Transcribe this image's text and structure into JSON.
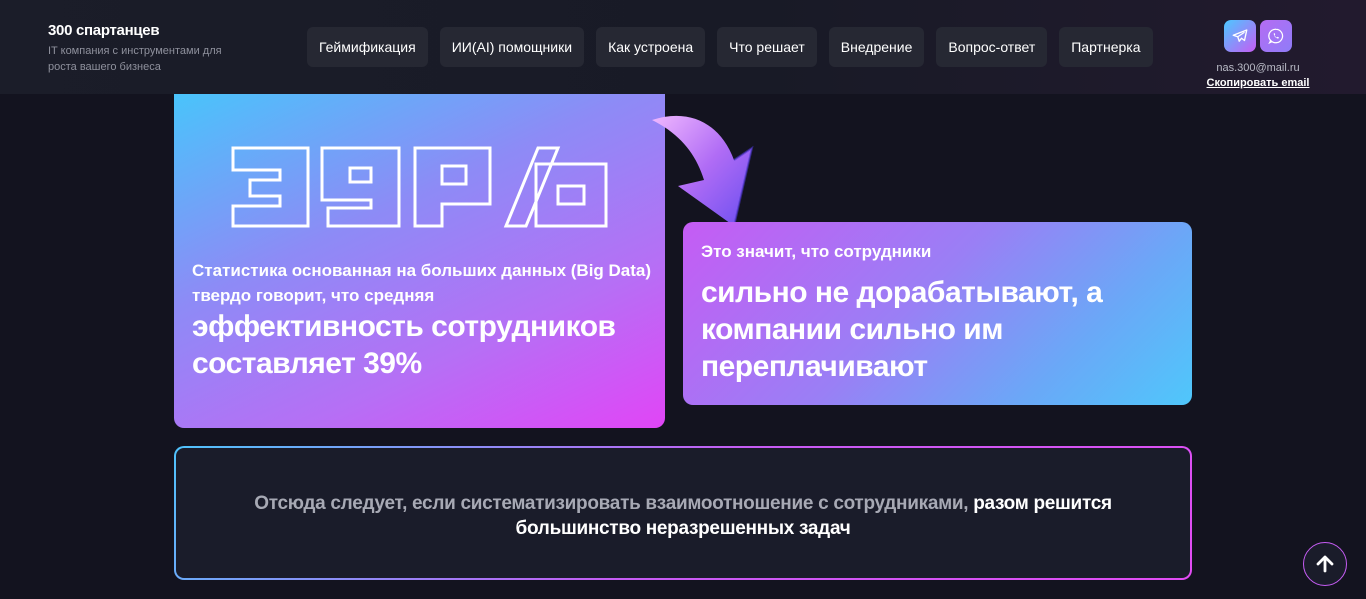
{
  "header": {
    "brand_title": "300 спартанцев",
    "brand_subtitle": "IT компания с инструментами для роста вашего бизнеса",
    "nav": [
      {
        "label": "Геймификация"
      },
      {
        "label": "ИИ(AI) помощники"
      },
      {
        "label": "Как устроена"
      },
      {
        "label": "Что решает"
      },
      {
        "label": "Внедрение"
      },
      {
        "label": "Вопрос-ответ"
      },
      {
        "label": "Партнерка"
      }
    ],
    "social": [
      {
        "icon": "telegram-icon"
      },
      {
        "icon": "whatsapp-icon"
      }
    ],
    "email": "nas.300@mail.ru",
    "copy_email_label": "Скопировать email"
  },
  "stat_card": {
    "big_number": "39%",
    "text_small": "Статистика основанная на больших данных (Big Data) твердо говорит, что средняя",
    "text_big": "эффективность сотрудников составляет 39%"
  },
  "meaning_card": {
    "text_small": "Это значит, что сотрудники",
    "text_big": "сильно не дорабатывают, а компании сильно им переплачивают"
  },
  "conclusion_card": {
    "text_muted": "Отсюда следует, если систематизировать взаимоотношение с сотрудниками,",
    "text_strong": "разом решится большинство неразрешенных задач"
  },
  "colors": {
    "accent_blue": "#4fc3fb",
    "accent_pink": "#e145f6",
    "accent_purple": "#c65cf4"
  },
  "scroll_top": {
    "icon": "arrow-up-icon"
  }
}
